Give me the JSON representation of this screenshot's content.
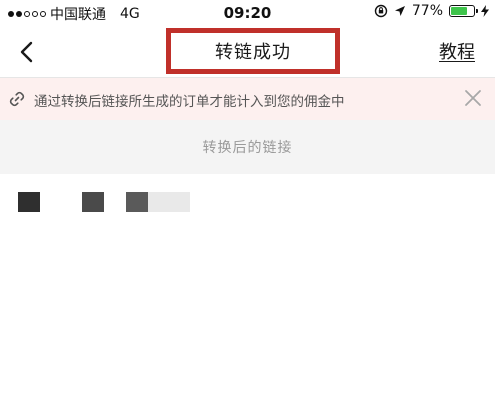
{
  "status_bar": {
    "carrier": "中国联通",
    "network": "4G",
    "time": "09:20",
    "battery_percent_label": "77%",
    "battery_level": 0.77,
    "signal_filled": 2,
    "signal_total": 5
  },
  "nav": {
    "title": "转链成功",
    "tutorial_label": "教程"
  },
  "notice": {
    "text": "通过转换后链接所生成的订单才能计入到您的佣金中"
  },
  "converted": {
    "label": "转换后的链接"
  },
  "colors": {
    "highlight_border": "#c0302a",
    "notice_bg": "#fdf0ef",
    "battery_green": "#3ec44b"
  }
}
